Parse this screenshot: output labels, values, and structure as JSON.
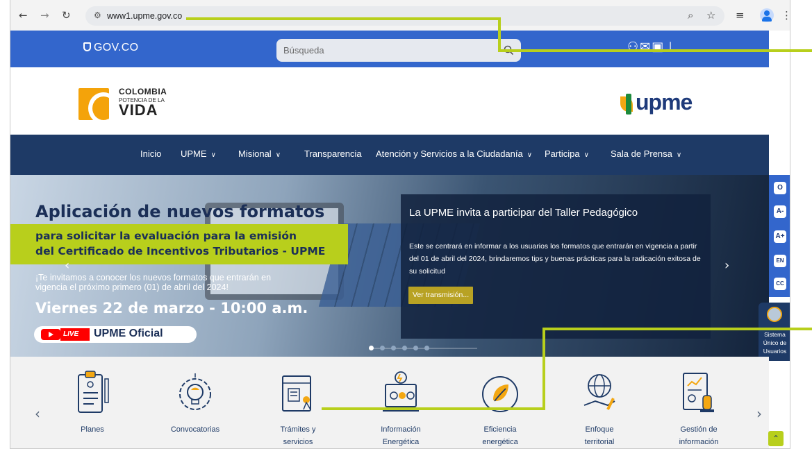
{
  "browser": {
    "url": "www1.upme.gov.co",
    "icons": [
      "back-icon",
      "forward-icon",
      "reload-icon",
      "site-info-icon",
      "zoom-icon",
      "bookmark-star-icon",
      "media-icon",
      "profile-icon",
      "menu-icon"
    ]
  },
  "gov_bar": {
    "logo": "GOV.CO",
    "search_placeholder": "Búsqueda",
    "icons": [
      "accessibility-icon",
      "mail-icon",
      "user-icon",
      "sitemap-icon"
    ]
  },
  "header": {
    "colombia_logo": {
      "line1": "COLOMBIA",
      "line2": "POTENCIA DE LA",
      "line3": "VIDA"
    },
    "upme_logo": "upme"
  },
  "menu": {
    "items": [
      {
        "label": "Inicio",
        "has_dropdown": false
      },
      {
        "label": "UPME",
        "has_dropdown": true
      },
      {
        "label": "Misional",
        "has_dropdown": true
      },
      {
        "label": "Transparencia",
        "has_dropdown": false
      },
      {
        "label": "Atención y Servicios a la Ciudadanía",
        "has_dropdown": true
      },
      {
        "label": "Participa",
        "has_dropdown": true
      },
      {
        "label": "Sala de Prensa",
        "has_dropdown": true
      }
    ]
  },
  "hero": {
    "promo": {
      "title": "Aplicación de nuevos formatos",
      "band_line1": "para solicitar la evaluación para la emisión",
      "band_line2": "del Certificado de Incentivos Tributarios - UPME",
      "invite_line1": "¡Te invitamos a conocer los nuevos formatos que entrarán en",
      "invite_line2": "vigencia el próximo primero (01) de abril del 2024!",
      "date": "Viernes 22 de marzo - 10:00 a.m.",
      "live_label": "LIVE",
      "channel": "UPME Oficial"
    },
    "overlay": {
      "title": "La UPME invita a participar del Taller Pedagógico",
      "text": "Este se centrará en informar a los usuarios los formatos que entrarán en vigencia a partir del 01 de abril del 2024, brindaremos tips y buenas prácticas para la radicación exitosa de su solicitud",
      "button": "Ver transmisión..."
    },
    "slides_total": 6,
    "active_slide": 1
  },
  "accessibility": {
    "buttons": [
      "O",
      "A-",
      "A+",
      "EN",
      "CC"
    ]
  },
  "suu": {
    "line1": "Sistema",
    "line2": "Único de",
    "line3": "Usuarios"
  },
  "services": {
    "items": [
      {
        "line1": "Planes",
        "line2": "",
        "icon": "planes-icon"
      },
      {
        "line1": "Convocatorias",
        "line2": "",
        "icon": "convocatorias-icon"
      },
      {
        "line1": "Trámites y",
        "line2": "servicios",
        "icon": "tramites-icon"
      },
      {
        "line1": "Información",
        "line2": "Energética",
        "icon": "informacion-icon"
      },
      {
        "line1": "Eficiencia",
        "line2": "energética",
        "icon": "eficiencia-icon"
      },
      {
        "line1": "Enfoque",
        "line2": "territorial",
        "icon": "enfoque-icon"
      },
      {
        "line1": "Gestión de",
        "line2": "información",
        "icon": "gestion-icon"
      }
    ]
  },
  "colors": {
    "gov_blue": "#3366cc",
    "navy": "#1e3a66",
    "accent_green": "#b8cf1c",
    "accent_orange": "#f3a712"
  }
}
